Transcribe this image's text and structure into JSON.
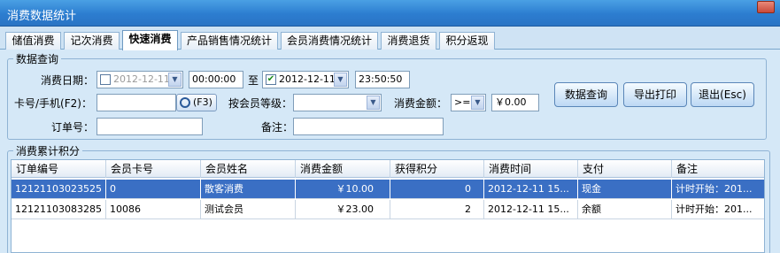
{
  "window": {
    "title": "消费数据统计"
  },
  "tabs": [
    {
      "label": "储值消费"
    },
    {
      "label": "记次消费"
    },
    {
      "label": "快速消费"
    },
    {
      "label": "产品销售情况统计"
    },
    {
      "label": "会员消费情况统计"
    },
    {
      "label": "消费退货"
    },
    {
      "label": "积分返现"
    }
  ],
  "query": {
    "legend": "数据查询",
    "date_label": "消费日期：",
    "start_date": "2012-12-11",
    "start_time": "00:00:00",
    "to_label": "至",
    "end_date": "2012-12-11",
    "end_time": "23:50:50",
    "card_label": "卡号/手机(F2)：",
    "card_value": "",
    "f3_label": "(F3)",
    "level_label": "按会员等级：",
    "level_value": "",
    "amount_label": "消费金额：",
    "amount_op": ">=",
    "amount_value": "￥0.00",
    "order_label": "订单号：",
    "order_value": "",
    "remark_label": "备注：",
    "remark_value": "",
    "btn_query": "数据查询",
    "btn_export": "导出打印",
    "btn_exit": "退出(Esc)"
  },
  "result": {
    "legend": "消费累计积分",
    "columns": [
      "订单编号",
      "会员卡号",
      "会员姓名",
      "消费金额",
      "获得积分",
      "消费时间",
      "支付",
      "备注"
    ],
    "rows": [
      [
        "12121103023525",
        "0",
        "散客消费",
        "￥10.00",
        "0",
        "2012-12-11 15...",
        "现金",
        "计时开始：201..."
      ],
      [
        "12121103083285",
        "10086",
        "测试会员",
        "￥23.00",
        "2",
        "2012-12-11 15...",
        "余额",
        "计时开始：201..."
      ]
    ]
  }
}
